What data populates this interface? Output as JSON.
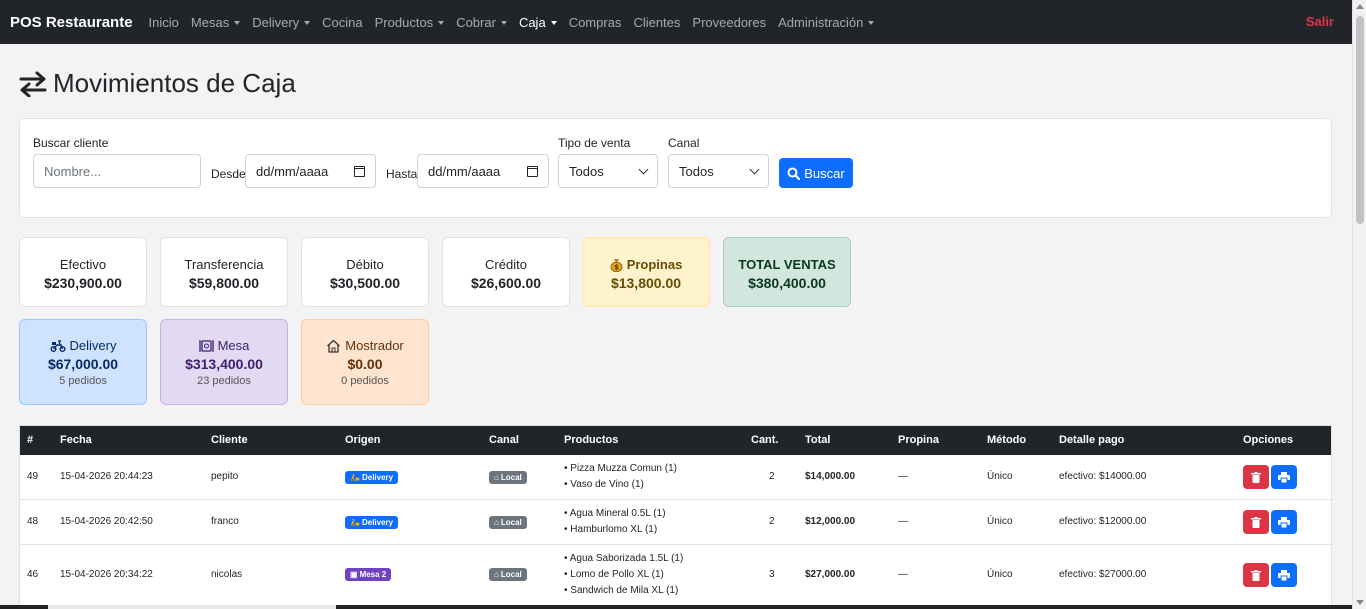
{
  "navbar": {
    "brand": "POS Restaurante",
    "items": [
      {
        "label": "Inicio",
        "dropdown": false,
        "active": false
      },
      {
        "label": "Mesas",
        "dropdown": true,
        "active": false
      },
      {
        "label": "Delivery",
        "dropdown": true,
        "active": false
      },
      {
        "label": "Cocina",
        "dropdown": false,
        "active": false
      },
      {
        "label": "Productos",
        "dropdown": true,
        "active": false
      },
      {
        "label": "Cobrar",
        "dropdown": true,
        "active": false
      },
      {
        "label": "Caja",
        "dropdown": true,
        "active": true
      },
      {
        "label": "Compras",
        "dropdown": false,
        "active": false
      },
      {
        "label": "Clientes",
        "dropdown": false,
        "active": false
      },
      {
        "label": "Proveedores",
        "dropdown": false,
        "active": false
      },
      {
        "label": "Administración",
        "dropdown": true,
        "active": false
      }
    ],
    "logout": "Salir"
  },
  "page": {
    "title": "Movimientos de Caja",
    "title_icon": "arrows-exchange-icon"
  },
  "filters": {
    "cliente_label": "Buscar cliente",
    "cliente_placeholder": "Nombre...",
    "desde_label": "Desde",
    "desde_value": "dd/mm/aaaa",
    "hasta_label": "Hasta",
    "hasta_value": "dd/mm/aaaa",
    "tipo_label": "Tipo de venta",
    "tipo_value": "Todos",
    "canal_label": "Canal",
    "canal_value": "Todos",
    "buscar_label": "Buscar"
  },
  "summary": {
    "efectivo": {
      "label": "Efectivo",
      "value": "$230,900.00"
    },
    "transferencia": {
      "label": "Transferencia",
      "value": "$59,800.00"
    },
    "debito": {
      "label": "Débito",
      "value": "$30,500.00"
    },
    "credito": {
      "label": "Crédito",
      "value": "$26,600.00"
    },
    "propinas": {
      "label": "Propinas",
      "value": "$13,800.00",
      "icon": "money-bag-icon"
    },
    "total": {
      "label": "TOTAL VENTAS",
      "value": "$380,400.00"
    }
  },
  "channels": {
    "delivery": {
      "label": "Delivery",
      "value": "$67,000.00",
      "count": "5 pedidos",
      "icon": "scooter-icon"
    },
    "mesa": {
      "label": "Mesa",
      "value": "$313,400.00",
      "count": "23 pedidos",
      "icon": "dining-table-icon"
    },
    "mostrador": {
      "label": "Mostrador",
      "value": "$0.00",
      "count": "0 pedidos",
      "icon": "house-icon"
    }
  },
  "table": {
    "headers": {
      "num": "#",
      "fecha": "Fecha",
      "cliente": "Cliente",
      "origen": "Origen",
      "canal": "Canal",
      "productos": "Productos",
      "cant": "Cant.",
      "total": "Total",
      "propina": "Propina",
      "metodo": "Método",
      "detalle": "Detalle pago",
      "opciones": "Opciones"
    },
    "rows": [
      {
        "num": "49",
        "fecha": "15-04-2026 20:44:23",
        "cliente": "pepito",
        "origen": "Delivery",
        "canal": "Local",
        "productos": [
          "• Pizza Muzza Comun (1)",
          "• Vaso de Vino (1)"
        ],
        "cant": "2",
        "total": "$14,000.00",
        "propina": "—",
        "metodo": "Único",
        "detalle": "efectivo: $14000.00"
      },
      {
        "num": "48",
        "fecha": "15-04-2026 20:42:50",
        "cliente": "franco",
        "origen": "Delivery",
        "canal": "Local",
        "productos": [
          "• Agua Mineral 0.5L (1)",
          "• Hamburlomo XL (1)"
        ],
        "cant": "2",
        "total": "$12,000.00",
        "propina": "—",
        "metodo": "Único",
        "detalle": "efectivo: $12000.00"
      },
      {
        "num": "46",
        "fecha": "15-04-2026 20:34:22",
        "cliente": "nicolas",
        "origen": "Mesa 2",
        "canal": "Local",
        "productos": [
          "• Agua Saborizada 1.5L (1)",
          "• Lomo de Pollo XL (1)",
          "• Sandwich de Mila XL (1)"
        ],
        "cant": "3",
        "total": "$27,000.00",
        "propina": "—",
        "metodo": "Único",
        "detalle": "efectivo: $27000.00"
      }
    ]
  }
}
